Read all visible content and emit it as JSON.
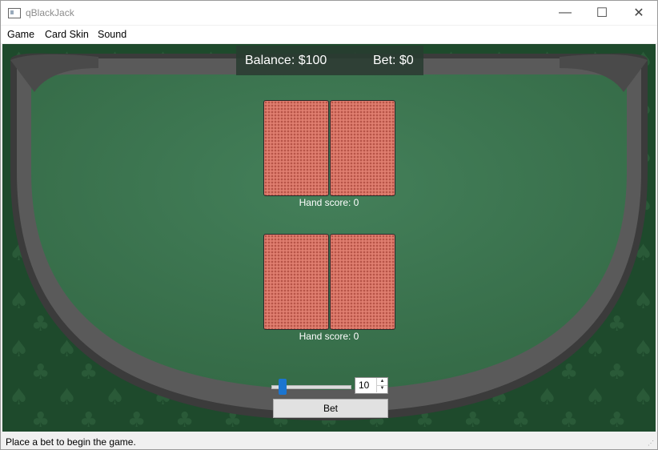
{
  "window": {
    "title": "qBlackJack",
    "minimize_glyph": "—",
    "maximize_glyph": "☐",
    "close_glyph": "✕"
  },
  "menu": {
    "items": [
      "Game",
      "Card Skin",
      "Sound"
    ]
  },
  "table": {
    "balance_text": "Balance: $100",
    "bet_text": "Bet: $0",
    "dealer_hand": {
      "score_text": "Hand score: 0",
      "cards": [
        "card-back",
        "card-back"
      ]
    },
    "player_hand": {
      "score_text": "Hand score: 0",
      "cards": [
        "card-back",
        "card-back"
      ]
    }
  },
  "controls": {
    "bet_slider": {
      "value": 10,
      "min": 0,
      "max": 100
    },
    "bet_spinbox": {
      "value": "10",
      "up_glyph": "▲",
      "down_glyph": "▼"
    },
    "bet_button_label": "Bet"
  },
  "statusbar": {
    "text": "Place a bet to begin the game.",
    "grip_glyph": "⋰"
  },
  "colors": {
    "felt": "#3e7a50",
    "rail": "#3b3b3b",
    "card_back": "#e07f70",
    "slider_handle": "#1b75d0"
  }
}
